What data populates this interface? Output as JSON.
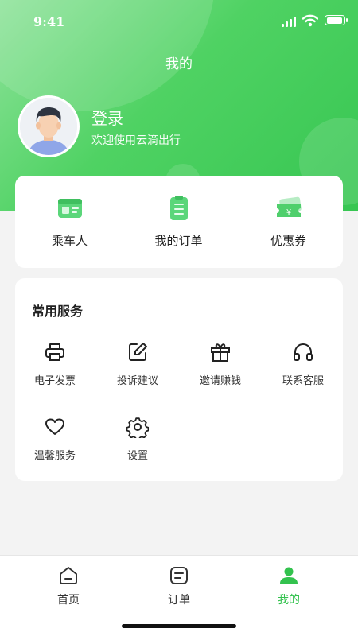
{
  "status_bar": {
    "time": "9:41"
  },
  "header": {
    "title": "我的",
    "user_name": "登录",
    "user_subtitle": "欢迎使用云滴出行"
  },
  "quick_actions": [
    {
      "label": "乘车人",
      "icon": "id-card-icon"
    },
    {
      "label": "我的订单",
      "icon": "clipboard-icon"
    },
    {
      "label": "优惠券",
      "icon": "coupon-icon"
    }
  ],
  "services": {
    "title": "常用服务",
    "items": [
      {
        "label": "电子发票",
        "icon": "printer-icon"
      },
      {
        "label": "投诉建议",
        "icon": "edit-icon"
      },
      {
        "label": "邀请赚钱",
        "icon": "gift-icon"
      },
      {
        "label": "联系客服",
        "icon": "headphones-icon"
      },
      {
        "label": "温馨服务",
        "icon": "heart-icon"
      },
      {
        "label": "设置",
        "icon": "gear-icon"
      }
    ]
  },
  "tabbar": {
    "items": [
      {
        "label": "首页",
        "icon": "home-icon"
      },
      {
        "label": "订单",
        "icon": "orders-icon"
      },
      {
        "label": "我的",
        "icon": "profile-icon"
      }
    ],
    "active": "我的"
  },
  "colors": {
    "accent": "#33c24e",
    "header_start": "#8fe39b",
    "header_end": "#37c652"
  }
}
